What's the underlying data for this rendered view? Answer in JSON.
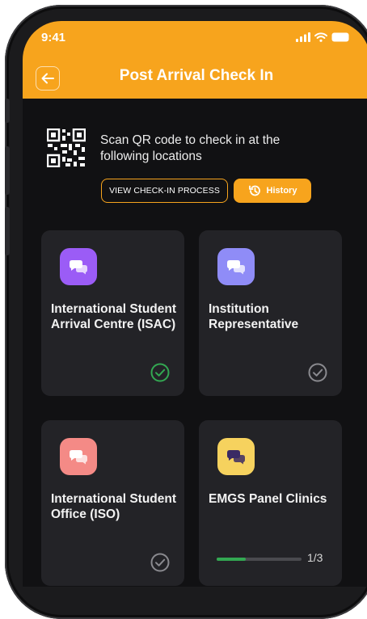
{
  "status_bar": {
    "time": "9:41"
  },
  "header": {
    "title": "Post Arrival Check In",
    "back_icon": "arrow-left-icon"
  },
  "scan": {
    "text": "Scan QR code to check in at the following locations",
    "icon": "qr-code-icon"
  },
  "actions": {
    "view_process_label": "VIEW CHECK-IN PROCESS",
    "history_label": "History",
    "history_icon": "history-icon"
  },
  "colors": {
    "accent": "#f7a41d",
    "background": "#111113",
    "card": "#232327",
    "success": "#33a852",
    "muted_check": "#8a8a8f"
  },
  "cards": [
    {
      "label": "International Student Arrival Centre (ISAC)",
      "icon_color": "#9b5cf6",
      "status": "checked"
    },
    {
      "label": "Institution Representative",
      "icon_color": "#8f8cf7",
      "status": "unchecked"
    },
    {
      "label": "International Student Office (ISO)",
      "icon_color": "#f48a86",
      "status": "unchecked"
    },
    {
      "label": "EMGS Panel Clinics",
      "icon_color": "#f6d25e",
      "status": "in-progress",
      "progress_text": "1/3",
      "progress": 0.34
    }
  ]
}
